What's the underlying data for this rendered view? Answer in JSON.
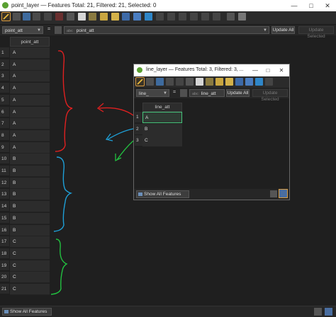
{
  "main": {
    "title": "point_layer — Features Total: 21, Filtered: 21, Selected: 0",
    "field_selector": "point_att",
    "equals": "=",
    "expression_prefix": "abc",
    "expression_value": "point_att",
    "update_all": "Update All",
    "update_selected": "Update Selected",
    "column_header": "point_att",
    "rows": [
      {
        "n": "1",
        "v": "A"
      },
      {
        "n": "2",
        "v": "A"
      },
      {
        "n": "3",
        "v": "A"
      },
      {
        "n": "4",
        "v": "A"
      },
      {
        "n": "5",
        "v": "A"
      },
      {
        "n": "6",
        "v": "A"
      },
      {
        "n": "7",
        "v": "A"
      },
      {
        "n": "8",
        "v": "A"
      },
      {
        "n": "9",
        "v": "A"
      },
      {
        "n": "10",
        "v": "B"
      },
      {
        "n": "11",
        "v": "B"
      },
      {
        "n": "12",
        "v": "B"
      },
      {
        "n": "13",
        "v": "B"
      },
      {
        "n": "14",
        "v": "B"
      },
      {
        "n": "15",
        "v": "B"
      },
      {
        "n": "16",
        "v": "B"
      },
      {
        "n": "17",
        "v": "C"
      },
      {
        "n": "18",
        "v": "C"
      },
      {
        "n": "19",
        "v": "C"
      },
      {
        "n": "20",
        "v": "C"
      },
      {
        "n": "21",
        "v": "C"
      }
    ],
    "show_all": "Show All Features"
  },
  "dialog": {
    "title": "line_layer — Features Total: 3, Filtered: 3, ...",
    "field_selector": "line_",
    "equals": "=",
    "expression_prefix": "abc",
    "expression_value": "line_att",
    "update_all": "Update All",
    "update_selected": "Update Selected",
    "column_header": "line_att",
    "rows": [
      {
        "n": "1",
        "v": "A"
      },
      {
        "n": "2",
        "v": "B"
      },
      {
        "n": "3",
        "v": "C"
      }
    ],
    "show_all": "Show All Features"
  },
  "colors": {
    "annotation_red": "#e02020",
    "annotation_blue": "#1ea0d8",
    "annotation_green": "#22c040"
  }
}
